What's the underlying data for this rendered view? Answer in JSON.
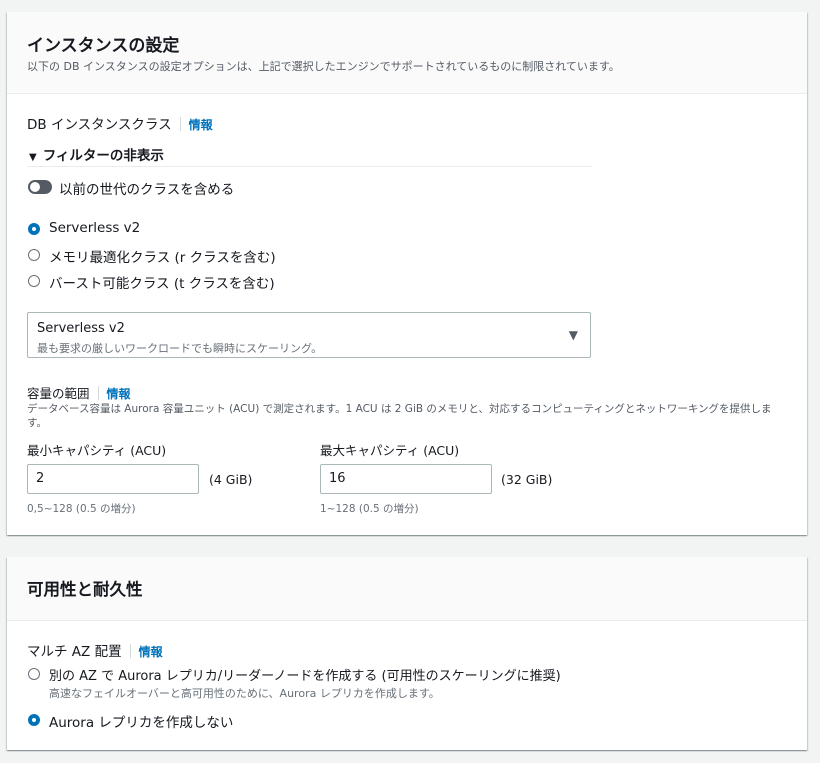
{
  "instance_settings": {
    "title": "インスタンスの設定",
    "description": "以下の DB インスタンスの設定オプションは、上記で選択したエンジンでサポートされているものに制限されています。",
    "db_instance_class_label": "DB インスタンスクラス",
    "info_link": "情報",
    "filter_toggle_label": "フィルターの非表示",
    "previous_gen_toggle_label": "以前の世代のクラスを含める",
    "previous_gen_toggle_on": false,
    "class_options": [
      {
        "label": "Serverless v2",
        "selected": true
      },
      {
        "label": "メモリ最適化クラス (r クラスを含む)",
        "selected": false
      },
      {
        "label": "バースト可能クラス (t クラスを含む)",
        "selected": false
      }
    ],
    "select": {
      "value": "Serverless v2",
      "description": "最も要求の厳しいワークロードでも瞬時にスケーリング。"
    },
    "capacity": {
      "label": "容量の範囲",
      "info_link": "情報",
      "description": "データベース容量は Aurora 容量ユニット (ACU) で測定されます。1 ACU は 2 GiB のメモリと、対応するコンピューティングとネットワーキングを提供します。",
      "min_label": "最小キャパシティ (ACU)",
      "min_value": "2",
      "min_suffix": "(4 GiB)",
      "min_hint": "0,5~128 (0.5 の増分)",
      "max_label": "最大キャパシティ (ACU)",
      "max_value": "16",
      "max_suffix": "(32 GiB)",
      "max_hint": "1~128 (0.5 の増分)"
    }
  },
  "availability": {
    "title": "可用性と耐久性",
    "multi_az_label": "マルチ AZ 配置",
    "info_link": "情報",
    "options": [
      {
        "label": "別の AZ で Aurora レプリカ/リーダーノードを作成する (可用性のスケーリングに推奨)",
        "description": "高速なフェイルオーバーと高可用性のために、Aurora レプリカを作成します。",
        "selected": false
      },
      {
        "label": "Aurora レプリカを作成しない",
        "selected": true
      }
    ]
  },
  "colors": {
    "accent": "#0073bb",
    "toggle_off": "#545b64",
    "background": "#f2f3f3"
  }
}
